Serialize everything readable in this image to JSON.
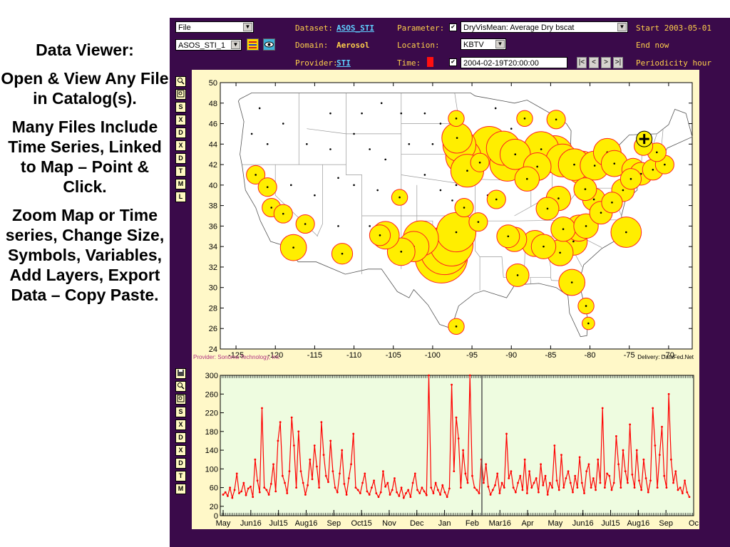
{
  "slide": {
    "paragraphs": [
      "Data Viewer:",
      "Open & View Any File in Catalog(s).",
      "Many Files Include Time Series, Linked to Map – Point & Click.",
      "Zoom Map or Time series, Change Size, Symbols, Variables, Add Layers, Export Data – Copy Paste."
    ]
  },
  "toolbar": {
    "file_menu": "File",
    "layer_select": "ASOS_STI_1",
    "dataset_label": "Dataset:",
    "dataset_value": "ASOS_STI",
    "domain_label": "Domain:",
    "domain_value": "Aerosol",
    "provider_label": "Provider:",
    "provider_value": "STI",
    "parameter_label": "Parameter:",
    "parameter_value": "DryVisMean: Average Dry bscat",
    "location_label": "Location:",
    "location_value": "KBTV",
    "time_label": "Time:",
    "time_value": "2004-02-19T20:00:00",
    "start_text": "Start 2003-05-01",
    "end_text": "End now",
    "periodicity_text": "Periodicity hour",
    "nav_first": "|<",
    "nav_prev": "<",
    "nav_next": ">",
    "nav_last": ">|"
  },
  "map_tools": [
    "zoom-icon",
    "zoom-box-icon",
    "S",
    "X",
    "D",
    "X",
    "D",
    "T",
    "M",
    "L"
  ],
  "ts_tools": [
    "save-icon",
    "zoom-icon",
    "zoom-box-icon",
    "S",
    "X",
    "D",
    "X",
    "D",
    "T",
    "M"
  ],
  "map": {
    "lon_ticks": [
      "-125",
      "-120",
      "-115",
      "-110",
      "-105",
      "-100",
      "-95",
      "-90",
      "-85",
      "-80",
      "-75",
      "-70"
    ],
    "lat_ticks": [
      "50",
      "48",
      "46",
      "44",
      "42",
      "40",
      "38",
      "36",
      "34",
      "32",
      "30",
      "28",
      "26",
      "24"
    ],
    "provider_credit": "Provider: Sonoma Technology, Inc",
    "delivery_credit": "Delivery: DataFed.Net",
    "colors": {
      "bubble_fill": "#ffee00",
      "bubble_stroke": "#ff2020",
      "bg": "#ffffff"
    }
  },
  "chart_data": [
    {
      "type": "scatter",
      "title": "",
      "x_range": [
        -127,
        -67
      ],
      "y_range": [
        24,
        50
      ],
      "points": [
        {
          "lon": -98.9,
          "lat": 33.0,
          "v": 34
        },
        {
          "lon": -98.5,
          "lat": 33.6,
          "v": 28
        },
        {
          "lon": -97.6,
          "lat": 34.2,
          "v": 22
        },
        {
          "lon": -97.0,
          "lat": 35.4,
          "v": 18
        },
        {
          "lon": -101.5,
          "lat": 34.8,
          "v": 14
        },
        {
          "lon": -102.4,
          "lat": 34.0,
          "v": 10
        },
        {
          "lon": -104.0,
          "lat": 33.5,
          "v": 8
        },
        {
          "lon": -106.0,
          "lat": 35.1,
          "v": 8
        },
        {
          "lon": -96.6,
          "lat": 43.9,
          "v": 12
        },
        {
          "lon": -96.1,
          "lat": 42.8,
          "v": 14
        },
        {
          "lon": -95.6,
          "lat": 41.4,
          "v": 12
        },
        {
          "lon": -96.9,
          "lat": 44.6,
          "v": 10
        },
        {
          "lon": -92.8,
          "lat": 43.9,
          "v": 16
        },
        {
          "lon": -91.0,
          "lat": 43.6,
          "v": 13
        },
        {
          "lon": -90.5,
          "lat": 42.1,
          "v": 14
        },
        {
          "lon": -89.5,
          "lat": 43.0,
          "v": 10
        },
        {
          "lon": -86.2,
          "lat": 43.5,
          "v": 14
        },
        {
          "lon": -84.5,
          "lat": 43.0,
          "v": 16
        },
        {
          "lon": -83.5,
          "lat": 42.4,
          "v": 12
        },
        {
          "lon": -82.0,
          "lat": 42.0,
          "v": 11
        },
        {
          "lon": -81.0,
          "lat": 41.7,
          "v": 12
        },
        {
          "lon": -79.4,
          "lat": 41.9,
          "v": 9
        },
        {
          "lon": -77.8,
          "lat": 43.2,
          "v": 8
        },
        {
          "lon": -76.9,
          "lat": 42.1,
          "v": 7
        },
        {
          "lon": -74.5,
          "lat": 41.5,
          "v": 5
        },
        {
          "lon": -86.7,
          "lat": 41.8,
          "v": 8
        },
        {
          "lon": -88.0,
          "lat": 40.6,
          "v": 6
        },
        {
          "lon": -84.0,
          "lat": 38.7,
          "v": 6
        },
        {
          "lon": -85.4,
          "lat": 37.7,
          "v": 5
        },
        {
          "lon": -83.4,
          "lat": 35.7,
          "v": 6
        },
        {
          "lon": -81.4,
          "lat": 35.8,
          "v": 7
        },
        {
          "lon": -82.1,
          "lat": 34.5,
          "v": 8
        },
        {
          "lon": -83.8,
          "lat": 33.4,
          "v": 7
        },
        {
          "lon": -85.9,
          "lat": 34.0,
          "v": 6
        },
        {
          "lon": -87.0,
          "lat": 34.3,
          "v": 7
        },
        {
          "lon": -89.6,
          "lat": 34.7,
          "v": 6
        },
        {
          "lon": -90.4,
          "lat": 35.0,
          "v": 5
        },
        {
          "lon": -89.2,
          "lat": 31.2,
          "v": 5
        },
        {
          "lon": -82.3,
          "lat": 30.5,
          "v": 7
        },
        {
          "lon": -79.5,
          "lat": 38.6,
          "v": 5
        },
        {
          "lon": -78.6,
          "lat": 37.3,
          "v": 5
        },
        {
          "lon": -80.6,
          "lat": 39.6,
          "v": 5
        },
        {
          "lon": -77.2,
          "lat": 38.3,
          "v": 4
        },
        {
          "lon": -75.8,
          "lat": 39.5,
          "v": 5
        },
        {
          "lon": -74.8,
          "lat": 40.6,
          "v": 4
        },
        {
          "lon": -73.5,
          "lat": 41.1,
          "v": 5
        },
        {
          "lon": -72.0,
          "lat": 41.5,
          "v": 4
        },
        {
          "lon": -70.5,
          "lat": 42.0,
          "v": 3
        },
        {
          "lon": -71.5,
          "lat": 43.2,
          "v": 3
        },
        {
          "lon": -73.2,
          "lat": 43.8,
          "v": 3
        },
        {
          "lon": -75.4,
          "lat": 35.4,
          "v": 10
        },
        {
          "lon": -80.5,
          "lat": 36.0,
          "v": 6
        },
        {
          "lon": -122.5,
          "lat": 41.0,
          "v": 3
        },
        {
          "lon": -121.0,
          "lat": 39.8,
          "v": 3
        },
        {
          "lon": -120.5,
          "lat": 37.8,
          "v": 3
        },
        {
          "lon": -119.0,
          "lat": 37.2,
          "v": 3
        },
        {
          "lon": -117.7,
          "lat": 33.9,
          "v": 7
        },
        {
          "lon": -116.2,
          "lat": 36.2,
          "v": 3
        },
        {
          "lon": -111.5,
          "lat": 33.3,
          "v": 4
        },
        {
          "lon": -106.7,
          "lat": 35.1,
          "v": 4
        },
        {
          "lon": -97.0,
          "lat": 46.5,
          "v": 2
        },
        {
          "lon": -104.2,
          "lat": 38.8,
          "v": 2
        },
        {
          "lon": -88.3,
          "lat": 46.5,
          "v": 2
        },
        {
          "lon": -84.3,
          "lat": 46.4,
          "v": 3
        },
        {
          "lon": -94.0,
          "lat": 42.2,
          "v": 3
        },
        {
          "lon": -91.9,
          "lat": 38.6,
          "v": 3
        },
        {
          "lon": -94.2,
          "lat": 36.4,
          "v": 3
        },
        {
          "lon": -96.0,
          "lat": 37.8,
          "v": 3
        },
        {
          "lon": -97.0,
          "lat": 26.2,
          "v": 2
        },
        {
          "lon": -80.5,
          "lat": 28.2,
          "v": 2
        },
        {
          "lon": -80.2,
          "lat": 26.5,
          "v": 1
        }
      ]
    },
    {
      "type": "line",
      "title": "",
      "ylim": [
        0,
        300
      ],
      "y_ticks": [
        0,
        20,
        60,
        100,
        140,
        180,
        220,
        260,
        300
      ],
      "x_tick_labels": [
        "May",
        "Jun16",
        "Jul15",
        "Aug16",
        "Sep",
        "Oct15",
        "Nov",
        "Dec",
        "Jan",
        "Feb",
        "Mar16",
        "Apr",
        "May",
        "Jun16",
        "Jul15",
        "Aug16",
        "Sep",
        "Oc"
      ],
      "series": [
        {
          "values": [
            45,
            50,
            42,
            60,
            38,
            55,
            90,
            48,
            52,
            70,
            44,
            58,
            62,
            40,
            120,
            75,
            50,
            230,
            60,
            55,
            45,
            68,
            110,
            52,
            160,
            200,
            85,
            70,
            48,
            95,
            210,
            150,
            60,
            180,
            95,
            70,
            45,
            65,
            120,
            78,
            150,
            105,
            60,
            200,
            130,
            85,
            72,
            160,
            95,
            60,
            50,
            90,
            140,
            68,
            45,
            80,
            110,
            175,
            60,
            55,
            48,
            70,
            90,
            52,
            45,
            60,
            75,
            48,
            40,
            50,
            95,
            62,
            70,
            45,
            55,
            80,
            50,
            42,
            60,
            38,
            48,
            55,
            40,
            70,
            90,
            55,
            48,
            60,
            52,
            44,
            300,
            60,
            48,
            70,
            55,
            45,
            65,
            50,
            40,
            58,
            280,
            95,
            210,
            165,
            60,
            140,
            90,
            70,
            300,
            85,
            60,
            55,
            48,
            120,
            70,
            110,
            62,
            45,
            55,
            65,
            90,
            48,
            70,
            60,
            175,
            80,
            95,
            60,
            50,
            70,
            85,
            55,
            120,
            48,
            95,
            60,
            70,
            80,
            50,
            110,
            65,
            85,
            45,
            70,
            60,
            150,
            75,
            55,
            130,
            60,
            80,
            95,
            70,
            50,
            85,
            60,
            125,
            70,
            48,
            95,
            110,
            60,
            80,
            55,
            120,
            70,
            230,
            60,
            90,
            85,
            55,
            70,
            170,
            110,
            60,
            140,
            95,
            70,
            195,
            88,
            60,
            140,
            75,
            55,
            120,
            80,
            50,
            75,
            230,
            150,
            60,
            130,
            190,
            85,
            60,
            260,
            120,
            70,
            95,
            55,
            60,
            48,
            75,
            50,
            40
          ]
        }
      ]
    }
  ]
}
